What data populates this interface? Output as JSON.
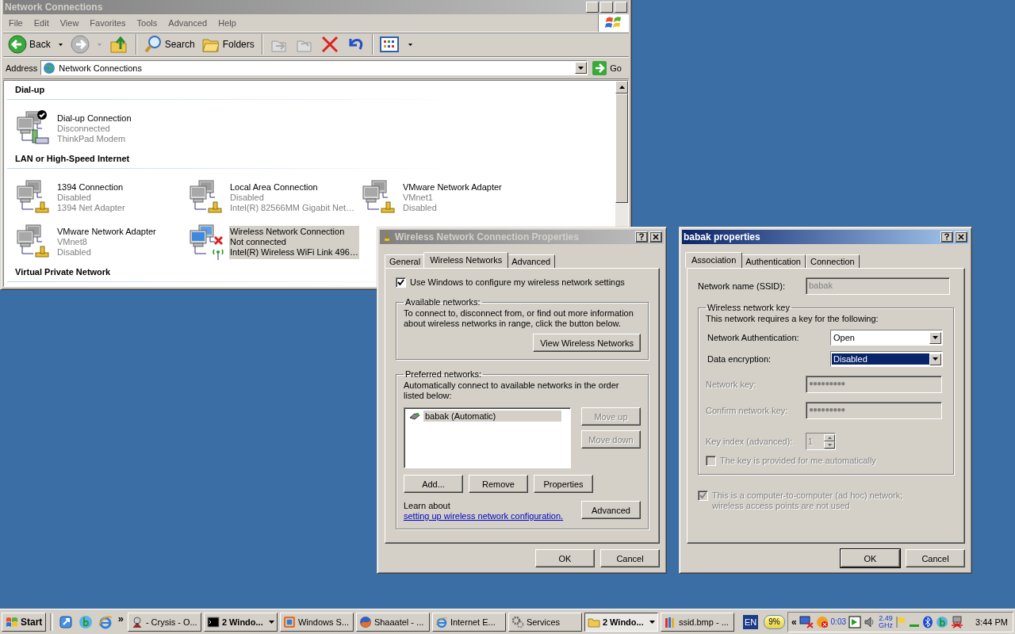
{
  "explorer": {
    "title": "Network Connections",
    "active": false,
    "menu": [
      "File",
      "Edit",
      "View",
      "Favorites",
      "Tools",
      "Advanced",
      "Help"
    ],
    "toolbar": {
      "back": "Back",
      "search": "Search",
      "folders": "Folders"
    },
    "address": {
      "label": "Address",
      "value": "Network Connections",
      "go": "Go"
    },
    "groups": [
      {
        "heading": "Dial-up",
        "items": [
          {
            "kind": "dialup",
            "name": "Dial-up Connection",
            "status": "Disconnected",
            "device": "ThinkPad Modem",
            "selected": false
          }
        ]
      },
      {
        "heading": "LAN or High-Speed Internet",
        "items": [
          {
            "kind": "lan",
            "name": "1394 Connection",
            "status": "Disabled",
            "device": "1394 Net Adapter",
            "selected": false
          },
          {
            "kind": "lan",
            "name": "Local Area Connection",
            "status": "Disabled",
            "device": "Intel(R) 82566MM Gigabit Net…",
            "selected": false
          },
          {
            "kind": "lan",
            "name": "VMware Network Adapter",
            "status": "VMnet1",
            "device": "Disabled",
            "selected": false
          },
          {
            "kind": "lan",
            "name": "VMware Network Adapter",
            "status": "VMnet8",
            "device": "Disabled",
            "selected": false
          },
          {
            "kind": "wireless",
            "name": "Wireless Network Connection",
            "status": "Not connected",
            "device": "Intel(R) Wireless WiFi Link 496…",
            "selected": true
          }
        ]
      },
      {
        "heading": "Virtual Private Network"
      }
    ]
  },
  "wireless_dialog": {
    "title": "Wireless Network Connection Properties",
    "active": false,
    "tabs": [
      {
        "label": "General",
        "selected": false
      },
      {
        "label": "Wireless Networks",
        "selected": true
      },
      {
        "label": "Advanced",
        "selected": false
      }
    ],
    "use_windows": {
      "label": "Use Windows to configure my wireless network settings",
      "checked": true
    },
    "available": {
      "legend": "Available networks:",
      "text": "To connect to, disconnect from, or find out more information about wireless networks in range, click the button below.",
      "button": "View Wireless Networks"
    },
    "preferred": {
      "legend": "Preferred networks:",
      "text": "Automatically connect to available networks in the order listed below:",
      "networks": [
        {
          "name": "babak (Automatic)",
          "selected": true
        }
      ],
      "side_buttons": [
        {
          "label": "Move up",
          "disabled": true
        },
        {
          "label": "Move down",
          "disabled": true
        }
      ],
      "row_buttons": [
        "Add...",
        "Remove",
        "Properties"
      ],
      "learn": "Learn about",
      "link": "setting up wireless network configuration.",
      "advanced": "Advanced"
    },
    "buttons": [
      "OK",
      "Cancel"
    ]
  },
  "babak_dialog": {
    "title": "babak properties",
    "active": true,
    "tabs": [
      {
        "label": "Association",
        "selected": true
      },
      {
        "label": "Authentication",
        "selected": false
      },
      {
        "label": "Connection",
        "selected": false
      }
    ],
    "ssid": {
      "label": "Network name (SSID):",
      "value": "babak",
      "disabled": true
    },
    "key_group": {
      "legend": "Wireless network key",
      "text": "This network requires a key for the following:",
      "authentication": {
        "label": "Network Authentication:",
        "value": "Open",
        "focused": false
      },
      "encryption": {
        "label": "Data encryption:",
        "value": "Disabled",
        "focused": true
      },
      "network_key": {
        "label": "Network key:",
        "value": "●●●●●●●●●",
        "disabled": true
      },
      "confirm_key": {
        "label": "Confirm network key:",
        "value": "●●●●●●●●●",
        "disabled": true
      },
      "key_index": {
        "label": "Key index (advanced):",
        "value": "1",
        "disabled": true
      },
      "auto_key": {
        "label": "The key is provided for me automatically",
        "checked": false,
        "disabled": true
      }
    },
    "adhoc": {
      "label": "This is a computer-to-computer (ad hoc) network; wireless access points are not used",
      "checked": true,
      "disabled": true
    },
    "buttons": [
      {
        "label": "OK",
        "default": true
      },
      {
        "label": "Cancel",
        "default": false
      }
    ]
  },
  "taskbar": {
    "start": "Start",
    "more": "»",
    "tasks": [
      {
        "kind": "game",
        "label": "- Crysis - O...",
        "grouped": false,
        "selected": false
      },
      {
        "kind": "console",
        "label": "2 Windo...",
        "grouped": true,
        "selected": false
      },
      {
        "kind": "vm",
        "label": "Windows S...",
        "grouped": false,
        "selected": false
      },
      {
        "kind": "firefox",
        "label": "Shaaatel - ...",
        "grouped": false,
        "selected": false
      },
      {
        "kind": "ie",
        "label": "Internet E...",
        "grouped": false,
        "selected": false
      },
      {
        "kind": "gear",
        "label": "Services",
        "grouped": false,
        "selected": false
      },
      {
        "kind": "folder",
        "label": "2 Windo...",
        "grouped": true,
        "selected": true
      },
      {
        "kind": "paint",
        "label": "ssid.bmp - ...",
        "grouped": false,
        "selected": false
      }
    ],
    "language": "EN",
    "battery": "9%",
    "tray_more": "«",
    "timer": "0:03",
    "cpu": {
      "value": "2.49",
      "unit": "GHz"
    },
    "clock": "3:44 PM"
  }
}
